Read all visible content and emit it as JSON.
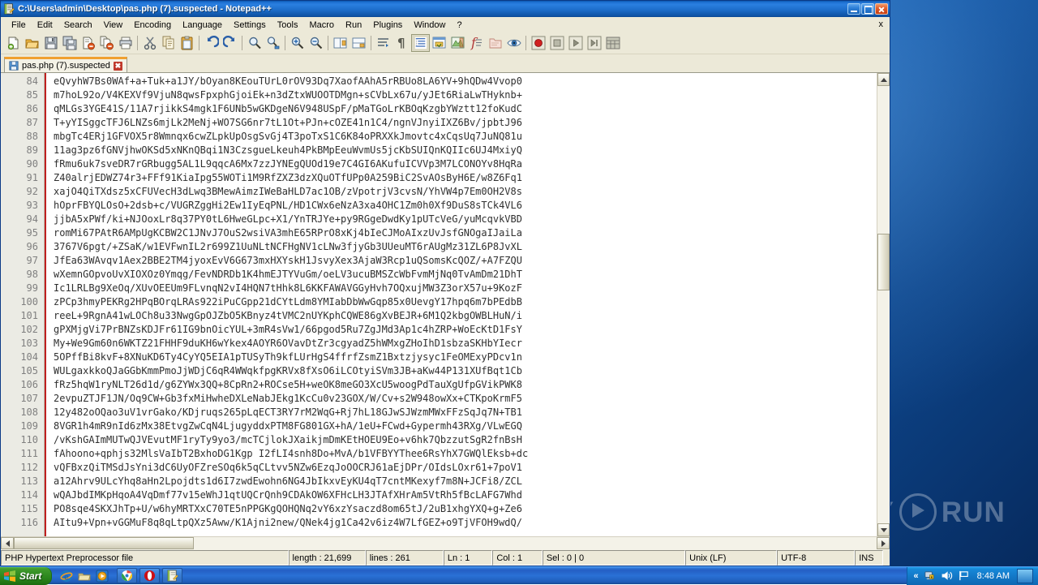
{
  "window": {
    "title": "C:\\Users\\admin\\Desktop\\pas.php (7).suspected - Notepad++",
    "icon": "notepadpp-icon",
    "minimize_label": "_",
    "maximize_label": "□",
    "close_label": "×"
  },
  "menubar": {
    "items": [
      {
        "label": "File"
      },
      {
        "label": "Edit"
      },
      {
        "label": "Search"
      },
      {
        "label": "View"
      },
      {
        "label": "Encoding"
      },
      {
        "label": "Language"
      },
      {
        "label": "Settings"
      },
      {
        "label": "Tools"
      },
      {
        "label": "Macro"
      },
      {
        "label": "Run"
      },
      {
        "label": "Plugins"
      },
      {
        "label": "Window"
      },
      {
        "label": "?"
      }
    ],
    "close_doc_label": "x"
  },
  "toolbar": {
    "buttons": [
      {
        "name": "new-file-icon",
        "tooltip": "New"
      },
      {
        "name": "open-file-icon",
        "tooltip": "Open"
      },
      {
        "name": "save-icon",
        "tooltip": "Save"
      },
      {
        "name": "save-all-icon",
        "tooltip": "Save All"
      },
      {
        "name": "close-file-icon",
        "tooltip": "Close"
      },
      {
        "name": "close-all-icon",
        "tooltip": "Close All"
      },
      {
        "name": "print-icon",
        "tooltip": "Print"
      },
      {
        "name": "separator",
        "tooltip": ""
      },
      {
        "name": "cut-icon",
        "tooltip": "Cut"
      },
      {
        "name": "copy-icon",
        "tooltip": "Copy"
      },
      {
        "name": "paste-icon",
        "tooltip": "Paste"
      },
      {
        "name": "separator",
        "tooltip": ""
      },
      {
        "name": "undo-icon",
        "tooltip": "Undo"
      },
      {
        "name": "redo-icon",
        "tooltip": "Redo"
      },
      {
        "name": "separator",
        "tooltip": ""
      },
      {
        "name": "find-icon",
        "tooltip": "Find"
      },
      {
        "name": "replace-icon",
        "tooltip": "Replace"
      },
      {
        "name": "separator",
        "tooltip": ""
      },
      {
        "name": "zoom-in-icon",
        "tooltip": "Zoom In"
      },
      {
        "name": "zoom-out-icon",
        "tooltip": "Zoom Out"
      },
      {
        "name": "separator",
        "tooltip": ""
      },
      {
        "name": "sync-vertical-icon",
        "tooltip": "Synchronize Vertical Scrolling"
      },
      {
        "name": "sync-horizontal-icon",
        "tooltip": "Synchronize Horizontal Scrolling"
      },
      {
        "name": "separator",
        "tooltip": ""
      },
      {
        "name": "word-wrap-icon",
        "tooltip": "Word wrap"
      },
      {
        "name": "show-all-chars-icon",
        "tooltip": "Show All Characters"
      },
      {
        "name": "indent-guide-icon",
        "tooltip": "Show Indent Guide"
      },
      {
        "name": "user-lang-icon",
        "tooltip": "User Defined Dialogue"
      },
      {
        "name": "doc-map-icon",
        "tooltip": "Document Map"
      },
      {
        "name": "function-list-icon",
        "tooltip": "Function List"
      },
      {
        "name": "folder-workspace-icon",
        "tooltip": "Folder as Workspace"
      },
      {
        "name": "monitoring-icon",
        "tooltip": "Monitoring"
      },
      {
        "name": "separator",
        "tooltip": ""
      },
      {
        "name": "record-macro-icon",
        "tooltip": "Start Recording"
      },
      {
        "name": "stop-macro-icon",
        "tooltip": "Stop Recording"
      },
      {
        "name": "play-macro-icon",
        "tooltip": "Playback"
      },
      {
        "name": "run-macro-multi-icon",
        "tooltip": "Run a Macro Multiple Times"
      },
      {
        "name": "save-macro-icon",
        "tooltip": "Save Current Recorded Macro"
      }
    ]
  },
  "tabs": [
    {
      "label": "pas.php (7).suspected",
      "icon": "save-blue-icon",
      "close_label": "✖",
      "active": true
    }
  ],
  "editor": {
    "first_line_number": 84,
    "lines": [
      {
        "n": "84",
        "text": "eQvyhW7Bs0WAf+a+Tuk+a1JY/bOyan8KEouTUrL0rOV93Dq7XaofAAhA5rRBUo8LA6YV+9hQDw4Vvop0"
      },
      {
        "n": "85",
        "text": "m7hoL92o/V4KEXVf9VjuN8qwsFpxphGjoiEk+n3dZtxWUOOTDMgn+sCVbLx67u/yJEt6RiaLwTHyknb+"
      },
      {
        "n": "86",
        "text": "qMLGs3YGE41S/11A7rjikkS4mgk1F6UNb5wGKDgeN6V948USpF/pMaTGoLrKBOqKzgbYWztt12foKudC"
      },
      {
        "n": "87",
        "text": "T+yYISggcTFJ6LNZs6mjLk2MeNj+WO7SG6nr7tL1Ot+PJn+cOZE41n1C4/ngnVJnyiIXZ6Bv/jpbtJ96"
      },
      {
        "n": "88",
        "text": "mbgTc4ERj1GFVOX5r8Wmnqx6cwZLpkUpOsgSvGj4T3poTxS1C6K84oPRXXkJmovtc4xCqsUq7JuNQ81u"
      },
      {
        "n": "89",
        "text": "11ag3pz6fGNVjhwOKSd5xNKnQBqi1N3CzsgueLkeuh4PkBMpEeuWvmUs5jcKbSUIQnKQIIc6UJ4MxiyQ"
      },
      {
        "n": "90",
        "text": "fRmu6uk7sveDR7rGRbugg5AL1L9qqcA6Mx7zzJYNEgQUOd19e7C4GI6AKufuICVVp3M7LCONOYv8HqRa"
      },
      {
        "n": "91",
        "text": "Z40alrjEDWZ74r3+FFf91KiaIpg55WOTi1M9RfZXZ3dzXQuOTfUPp0A259BiC2SvAOsByH6E/w8Z6Fq1"
      },
      {
        "n": "92",
        "text": "xajO4QiTXdsz5xCFUVecH3dLwq3BMewAimzIWeBaHLD7ac1OB/zVpotrjV3cvsN/YhVW4p7Em0OH2V8s"
      },
      {
        "n": "93",
        "text": "hOprFBYQLOsO+2dsb+c/VUGRZggHi2Ew1IyEqPNL/HD1CWx6eNzA3xa4OHC1Zm0h0Xf9DuS8sTCk4VL6"
      },
      {
        "n": "94",
        "text": "jjbA5xPWf/ki+NJOoxLr8q37PY0tL6HweGLpc+X1/YnTRJYe+py9RGgeDwdKy1pUTcVeG/yuMcqvkVBD"
      },
      {
        "n": "95",
        "text": "romMi67PAtR6AMpUgKCBW2C1JNvJ7OuS2wsiVA3mhE65RPrO8xKj4bIeCJMoAIxzUvJsfGNOgaIJaiLa"
      },
      {
        "n": "96",
        "text": "3767V6pgt/+ZSaK/w1EVFwnIL2r699Z1UuNLtNCFHgNV1cLNw3fjyGb3UUeuMT6rAUgMz31ZL6P8JvXL"
      },
      {
        "n": "97",
        "text": "JfEa63WAvqv1Aex2BBE2TM4jyoxEvV6G673mxHXYskH1JsvyXex3AjaW3Rcp1uQSomsKcQOZ/+A7FZQU"
      },
      {
        "n": "98",
        "text": "wXemnGOpvoUvXIOXOz0Ymqg/FevNDRDb1K4hmEJTYVuGm/oeLV3ucuBMSZcWbFvmMjNq0TvAmDm21DhT"
      },
      {
        "n": "99",
        "text": "Ic1LRLBg9XeOq/XUvOEEUm9FLvnqN2vI4HQN7tHhk8L6KKFAWAVGGyHvh7OQxujMW3Z3orX57u+9KozF"
      },
      {
        "n": "100",
        "text": "zPCp3hmyPEKRg2HPqBOrqLRAs922iPuCGpp21dCYtLdm8YMIabDbWwGqp85x0UevgY17hpq6m7bPEdbB"
      },
      {
        "n": "101",
        "text": "reeL+9RgnA41wLOCh8u33NwgGpOJZbO5KBnyz4tVMC2nUYKphCQWE86gXvBEJR+6M1Q2kbgOWBLHuN/i"
      },
      {
        "n": "102",
        "text": "gPXMjgVi7PrBNZsKDJFr61IG9bnOicYUL+3mR4sVw1/66pgod5Ru7ZgJMd3Ap1c4hZRP+WoEcKtD1FsY"
      },
      {
        "n": "103",
        "text": "My+We9Gm60n6WKTZ21FHHF9duKH6wYkex4AOYR6OVavDtZr3cgyadZ5hWMxgZHoIhD1sbzaSKHbYIecr"
      },
      {
        "n": "104",
        "text": "5OPffBi8kvF+8XNuKD6Ty4CyYQ5EIA1pTUSyTh9kfLUrHgS4ffrfZsmZ1Bxtzjysyc1FeOMExyPDcv1n"
      },
      {
        "n": "105",
        "text": "WULgaxkkoQJaGGbKmmPmoJjWDjC6qR4WWqkfpgKRVx8fXsO6iLCOtyiSVm3JB+aKw44P131XUfBqt1Cb"
      },
      {
        "n": "106",
        "text": "fRz5hqW1ryNLT26d1d/g6ZYWx3QQ+8CpRn2+ROCse5H+weOK8meGO3XcU5woogPdTauXgUfpGVikPWK8"
      },
      {
        "n": "107",
        "text": "2evpuZTJF1JN/Oq9CW+Gb3fxMiHwheDXLeNabJEkg1KcCu0v23GOX/W/Cv+s2W948owXx+CTKpoKrmF5"
      },
      {
        "n": "108",
        "text": "12y482oOQao3uV1vrGako/KDjruqs265pLqECT3RY7rM2WqG+Rj7hL18GJwSJWzmMWxFFzSqJq7N+TB1"
      },
      {
        "n": "109",
        "text": "8VGR1h4mR9nId6zMx38EtvgZwCqN4LjugyddxPTM8FG801GX+hA/1eU+FCwd+Gypermh43RXg/VLwEGQ"
      },
      {
        "n": "110",
        "text": "/vKshGAImMUTwQJVEvutMF1ryTy9yo3/mcTCjlokJXaikjmDmKEtHOEU9Eo+v6hk7QbzzutSgR2fnBsH"
      },
      {
        "n": "111",
        "text": "fAhoono+qphjs32MlsVaIbT2BxhoDG1Kgp I2fLI4snh8Do+MvA/b1VFBYYThee6RsYhX7GWQlEksb+dc"
      },
      {
        "n": "112",
        "text": "vQFBxzQiTMSdJsYni3dC6UyOFZreSOq6k5qCLtvv5NZw6EzqJoOOCRJ61aEjDPr/OIdsLOxr61+7poV1"
      },
      {
        "n": "113",
        "text": "a12Ahrv9ULcYhq8aHn2Lpojdts1d6I7zwdEwohn6NG4JbIkxvEyKU4qT7cntMKexyf7m8N+JCFi8/ZCL"
      },
      {
        "n": "114",
        "text": "wQAJbdIMKpHqoA4VqDmf77v15eWhJ1qtUQCrQnh9CDAkOW6XFHcLH3JTAfXHrAm5VtRh5fBcLAFG7Whd"
      },
      {
        "n": "115",
        "text": "PO8sqe4SKXJhTp+U/w6hyMRTXxC70TE5nPPGKgQOHQNq2vY6xzYsaczd8om65tJ/2uB1xhgYXQ+g+Ze6"
      },
      {
        "n": "116",
        "text": "AItu9+Vpn+vGGMuF8q8qLtpQXz5Aww/K1Ajni2new/QNek4jg1Ca42v6iz4W7LfGEZ+o9TjVFOH9wdQ/"
      }
    ]
  },
  "statusbar": {
    "doc_type": "PHP Hypertext Preprocessor file",
    "length_label": "length : 21,699",
    "lines_label": "lines : 261",
    "ln_label": "Ln : 1",
    "col_label": "Col : 1",
    "sel_label": "Sel : 0 | 0",
    "eol": "Unix (LF)",
    "encoding": "UTF-8",
    "insert_mode": "INS"
  },
  "taskbar": {
    "start_label": "Start",
    "quicklaunch": [
      {
        "name": "internet-explorer-icon"
      },
      {
        "name": "show-desktop-folder-icon"
      },
      {
        "name": "media-player-icon"
      }
    ],
    "tasks": [
      {
        "name": "chrome-icon"
      },
      {
        "name": "opera-icon"
      },
      {
        "name": "notepadpp-task-icon"
      }
    ],
    "tray": {
      "expand_label": "«",
      "icons": [
        {
          "name": "network-security-icon"
        },
        {
          "name": "volume-icon"
        },
        {
          "name": "flag-icon"
        }
      ],
      "time": "8:48 AM",
      "show_desktop_name": "show-desktop-button"
    }
  },
  "watermark": {
    "text_left": "ANY",
    "text_right": "RUN",
    "logo_name": "anyrun-play-logo"
  }
}
